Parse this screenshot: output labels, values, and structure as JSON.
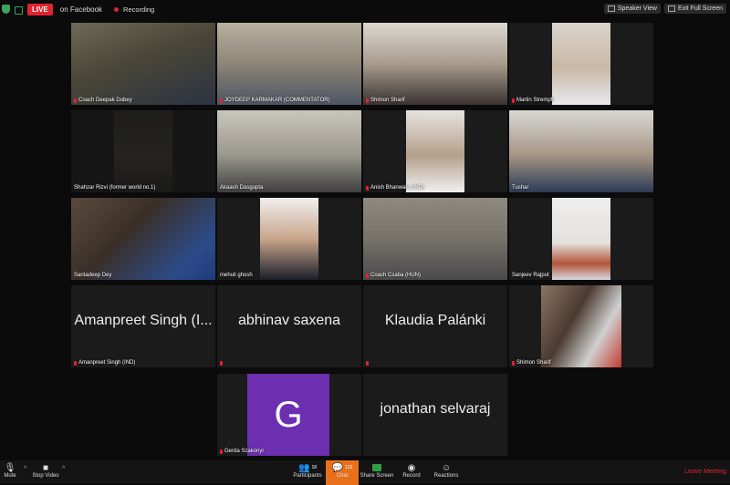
{
  "topbar": {
    "live_label": "LIVE",
    "stream_target": "on Facebook",
    "recording_label": "Recording",
    "speaker_view": "Speaker View",
    "exit_full_screen": "Exit Full Screen"
  },
  "tiles": [
    {
      "name": "Coach Deepak Dubey"
    },
    {
      "name": "JOYDEEP KARMAKAR (COMMENTATOR)"
    },
    {
      "name": "Shimon Sharif"
    },
    {
      "name": "Martin Strempfl"
    },
    {
      "name": "Shahzar Rizvi (former world no.1)"
    },
    {
      "name": "Akaash Dasgupta"
    },
    {
      "name": "Anish Bhanwala (IND)"
    },
    {
      "name": "Tushar"
    },
    {
      "name": "Santadeep Dey"
    },
    {
      "name": "mehuli ghosh"
    },
    {
      "name": "Coach Csaba (HUN)"
    },
    {
      "name": "Sanjeev Rajput"
    },
    {
      "name": "Amanpreet Singh (IND)",
      "display": "Amanpreet Singh (I..."
    },
    {
      "name": "",
      "display": "abhinav saxena"
    },
    {
      "name": "",
      "display": "Klaudia Palánki"
    },
    {
      "name": "Shimon Sharif"
    },
    {
      "name": "Gerda Szakonyi",
      "avatar_letter": "G"
    },
    {
      "name": "",
      "display": "jonathan selvaraj"
    }
  ],
  "toolbar": {
    "mute": "Mute",
    "stop_video": "Stop Video",
    "participants": "Participants",
    "participants_count": "18",
    "chat": "Chat",
    "chat_count": "122",
    "share_screen": "Share Screen",
    "record": "Record",
    "reactions": "Reactions",
    "leave": "Leave Meeting"
  },
  "colors": {
    "live_red": "#e0242f",
    "active_speaker": "#c8da2b",
    "chat_orange": "#e8701a",
    "avatar_purple": "#6b2fb0"
  }
}
